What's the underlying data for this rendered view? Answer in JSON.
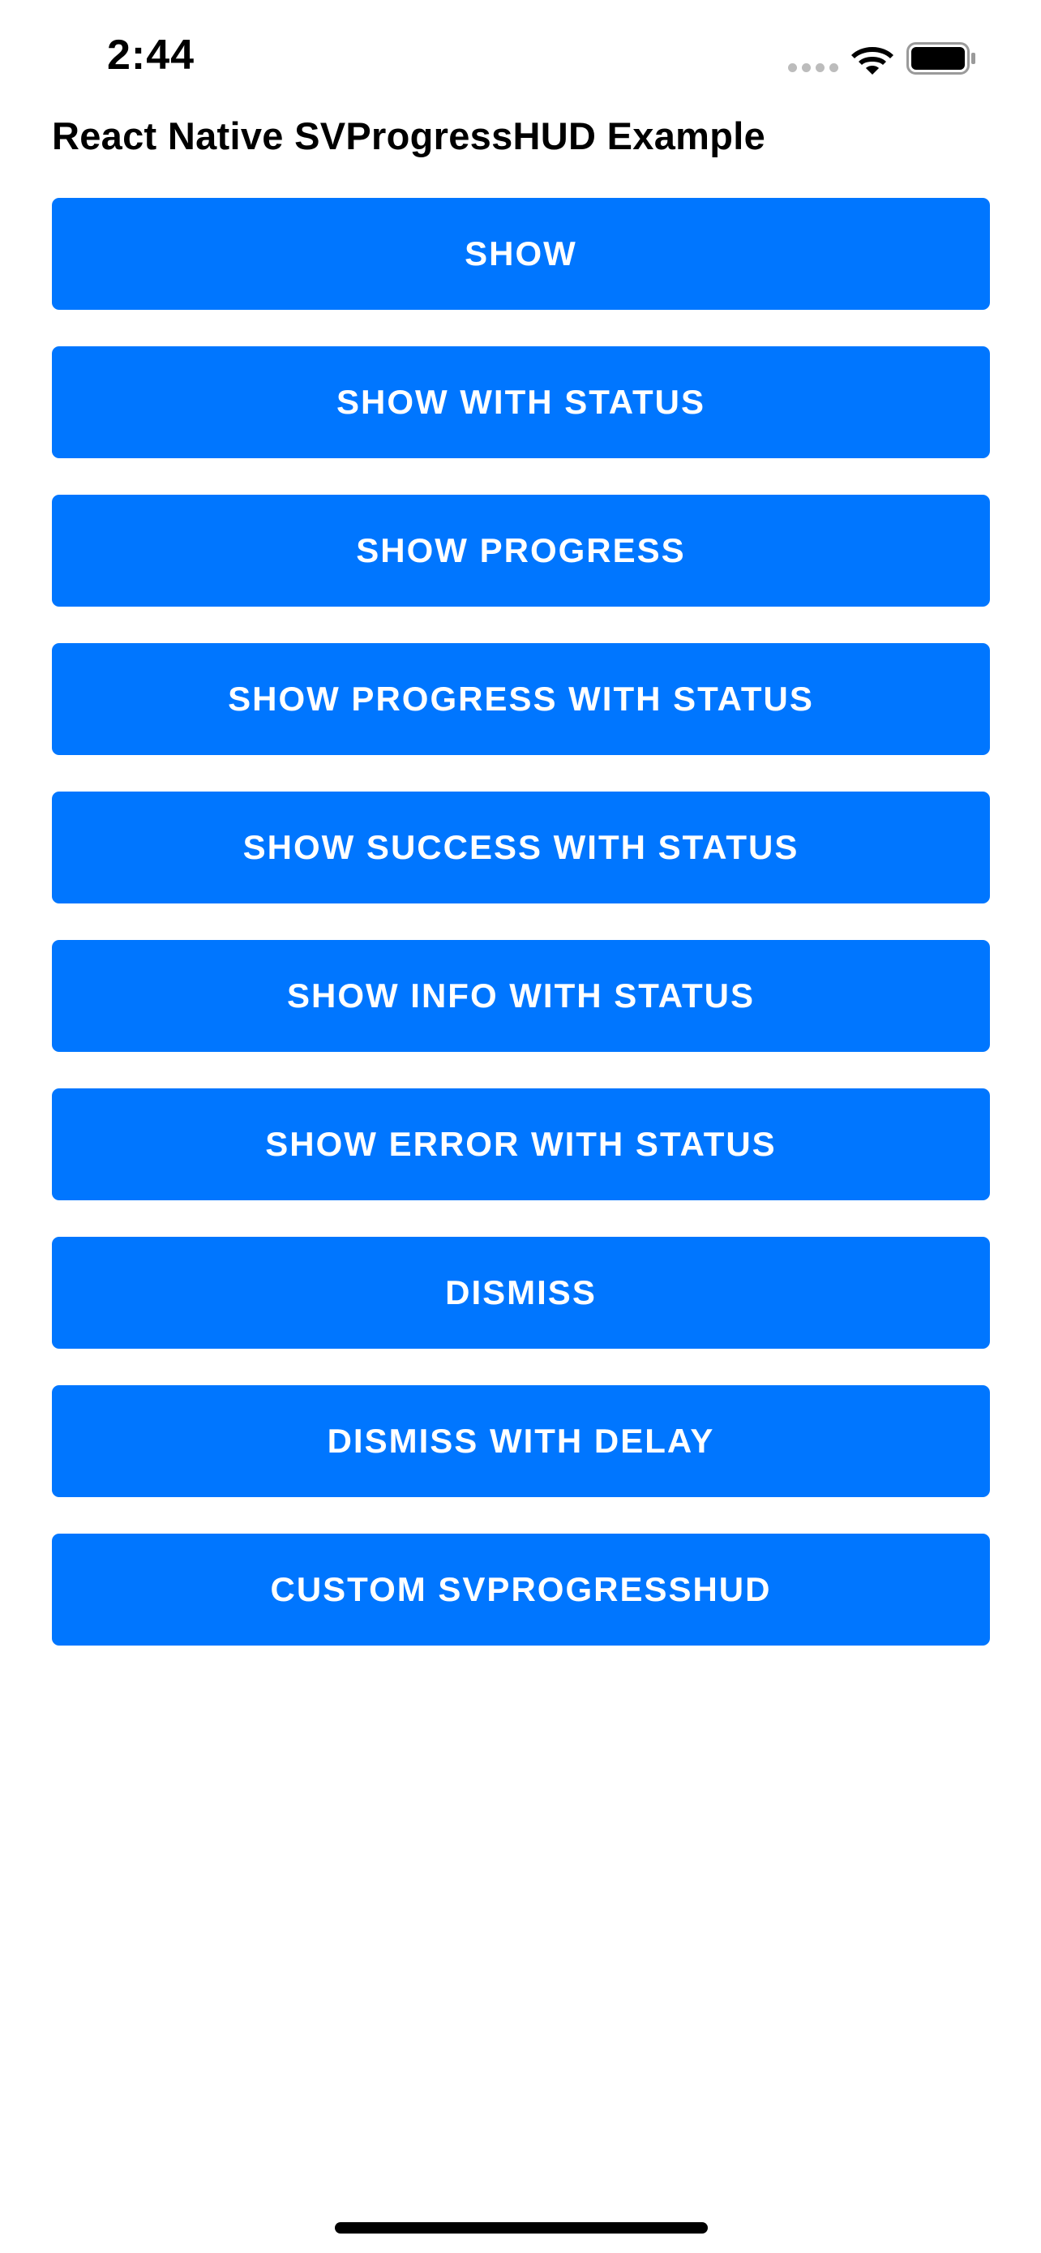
{
  "status_bar": {
    "time": "2:44",
    "icons": [
      "signal-dots-icon",
      "wifi-icon",
      "battery-icon"
    ]
  },
  "page": {
    "title": "React Native SVProgressHUD Example"
  },
  "colors": {
    "button_background": "#0076ff",
    "button_text": "#ffffff",
    "background": "#ffffff",
    "text": "#000000"
  },
  "buttons": [
    {
      "label": "SHOW"
    },
    {
      "label": "SHOW WITH STATUS"
    },
    {
      "label": "SHOW PROGRESS"
    },
    {
      "label": "SHOW PROGRESS WITH STATUS"
    },
    {
      "label": "SHOW SUCCESS WITH STATUS"
    },
    {
      "label": "SHOW INFO WITH STATUS"
    },
    {
      "label": "SHOW ERROR WITH STATUS"
    },
    {
      "label": "DISMISS"
    },
    {
      "label": "DISMISS WITH DELAY"
    },
    {
      "label": "CUSTOM SVPROGRESSHUD"
    }
  ]
}
